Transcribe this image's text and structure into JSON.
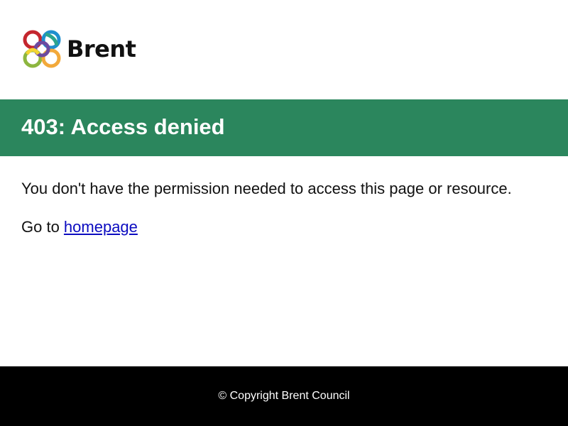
{
  "header": {
    "logo_text": "Brent",
    "logo_colors": [
      "#c4262e",
      "#1f8fcf",
      "#8db63f",
      "#f2a93b",
      "#6b4aa0",
      "#f3d532"
    ]
  },
  "banner": {
    "title": "403: Access denied",
    "background": "#2b865d"
  },
  "content": {
    "message": "You don't have the permission needed to access this page or resource.",
    "goto_prefix": "Go to ",
    "homepage_link": "homepage",
    "link_color": "#0b0bc0"
  },
  "footer": {
    "copyright": "© Copyright Brent Council"
  }
}
